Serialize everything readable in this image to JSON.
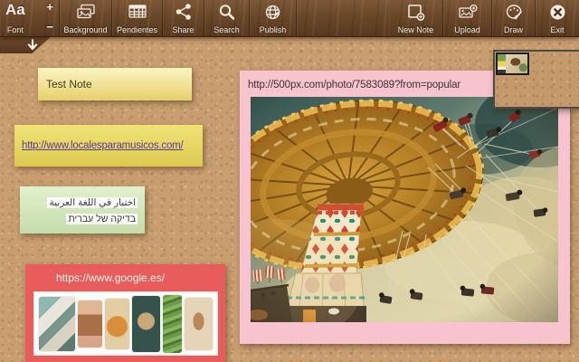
{
  "toolbar": {
    "font_sample": "Aa",
    "increase_label": "+",
    "decrease_label": "−",
    "items": [
      {
        "label": "Font",
        "icon": "font-icon"
      },
      {
        "label": "Background",
        "icon": "background-image-icon"
      },
      {
        "label": "Pendientes",
        "icon": "grid-list-icon"
      },
      {
        "label": "Share",
        "icon": "share-icon"
      },
      {
        "label": "Search",
        "icon": "search-icon"
      },
      {
        "label": "Publish",
        "icon": "globe-icon"
      },
      {
        "label": "New Note",
        "icon": "new-note-icon"
      },
      {
        "label": "Upload",
        "icon": "upload-image-icon"
      },
      {
        "label": "Draw",
        "icon": "palette-icon"
      },
      {
        "label": "Exit",
        "icon": "exit-icon"
      }
    ],
    "hide_toolbar_icon": "arrow-down-icon"
  },
  "notes": {
    "test": {
      "text": "Test Note"
    },
    "link": {
      "url": "http://www.localesparamusicos.com/"
    },
    "multilingual": {
      "arabic": "اختبار في اللغة العربية",
      "hebrew": "בדיקה של עברית"
    },
    "google": {
      "url": "https://www.google.es/"
    },
    "photo": {
      "url": "http://500px.com/photo/7583089?from=popular"
    }
  },
  "colors": {
    "cork_background": "#c89e70",
    "toolbar_wood": "#6b4729",
    "note_yellow_light": "#f5e9a0",
    "note_yellow_saturated": "#e5d462",
    "note_green": "#d2e5b8",
    "note_red": "#e85c5c",
    "note_pink": "#f6c3ce",
    "visited_link_purple": "#5a3a9a"
  }
}
